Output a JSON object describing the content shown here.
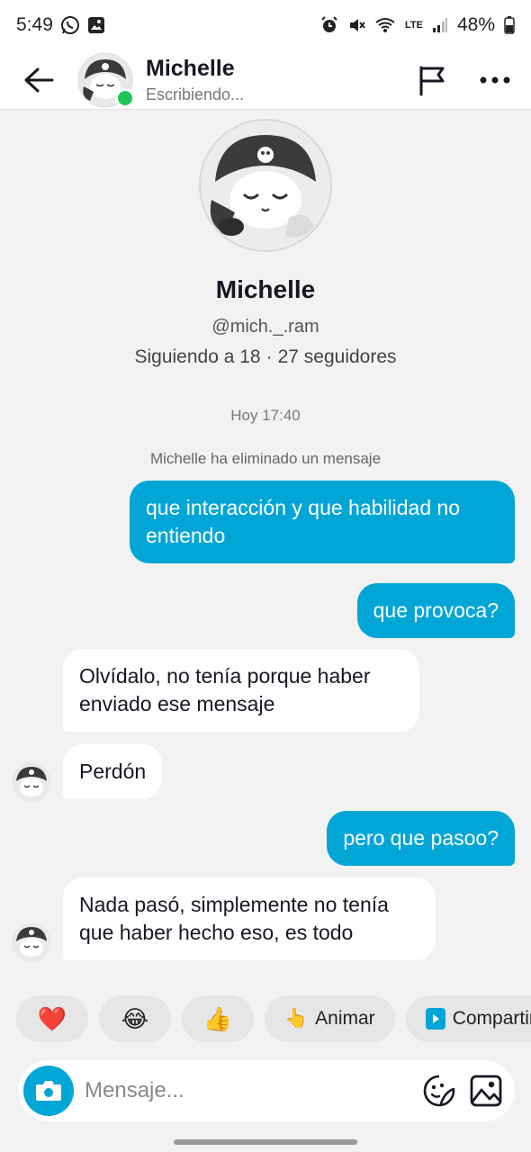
{
  "status_bar": {
    "time": "5:49",
    "battery": "48%",
    "lte_label": "LTE"
  },
  "header": {
    "name": "Michelle",
    "status": "Escribiendo..."
  },
  "profile": {
    "name": "Michelle",
    "username": "@mich._.ram",
    "following": "Siguiendo a 18",
    "separator": "·",
    "followers": "27 seguidores"
  },
  "chat": {
    "timestamp": "Hoy 17:40",
    "system_message": "Michelle ha eliminado un mensaje",
    "messages": [
      {
        "direction": "out",
        "text": "que interacción y que habilidad no entiendo"
      },
      {
        "direction": "out",
        "text": "que provoca?"
      },
      {
        "direction": "in",
        "text": "Olvídalo, no tenía porque haber enviado ese mensaje"
      },
      {
        "direction": "in",
        "text": "Perdón"
      },
      {
        "direction": "out",
        "text": "pero que pasoo?"
      },
      {
        "direction": "in",
        "text": "Nada pasó, simplemente no tenía que haber hecho eso, es todo"
      }
    ]
  },
  "quick_replies": {
    "heart": "❤️",
    "laugh": "😂",
    "thumbs": "👍",
    "animar_emoji": "👆",
    "animar": "Animar",
    "share": "Compartir"
  },
  "composer": {
    "placeholder": "Mensaje..."
  },
  "colors": {
    "accent": "#02a6d6",
    "online": "#20c55a",
    "background": "#f2f2f2"
  }
}
